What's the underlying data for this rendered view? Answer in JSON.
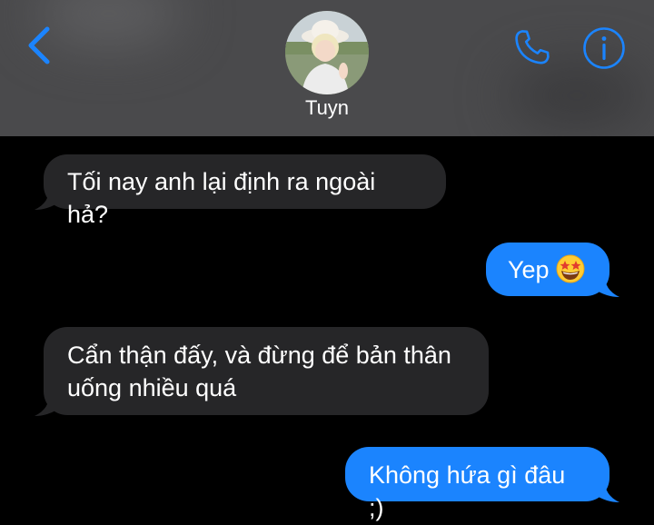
{
  "header": {
    "contact_name": "Tuyn"
  },
  "messages": [
    {
      "direction": "received",
      "text": "Tối nay anh lại định ra ngoài hả?"
    },
    {
      "direction": "sent",
      "text": "Yep",
      "emoji": "star-struck"
    },
    {
      "direction": "received",
      "lines": [
        "Cẩn thận đấy, và đừng để bản thân",
        "uống nhiều quá"
      ]
    },
    {
      "direction": "sent",
      "text": "Không hứa gì đâu ;)"
    }
  ],
  "colors": {
    "header_bg": "#4a4a4c",
    "accent": "#1b84fe",
    "received_bubble": "#262628",
    "sent_bubble": "#1b84fe",
    "background": "#000000"
  }
}
